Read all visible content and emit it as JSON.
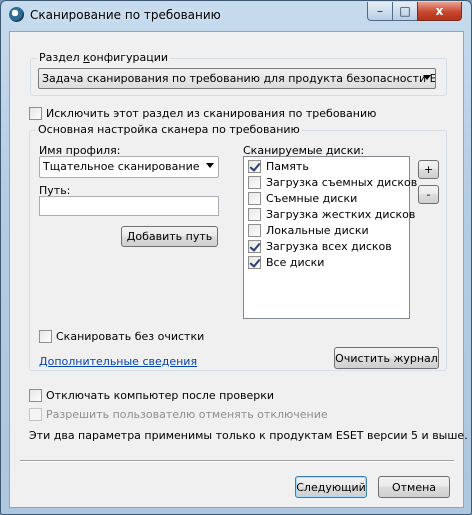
{
  "window": {
    "title": "Сканирование по требованию",
    "controls": {
      "minimize": "–",
      "maximize": "□",
      "close": "x"
    }
  },
  "config_section": {
    "label": "Раздел конфигурации",
    "label_underline_char": "к",
    "selected": "Задача сканирования по требованию для продукта безопасности ESET д"
  },
  "exclude_section": {
    "label": "Исключить этот раздел из сканирования по требованию",
    "checked": false
  },
  "scanner": {
    "group_title": "Основная настройка сканера по требованию",
    "profile_label": "Имя профиля:",
    "profile_value": "Тщательное сканирование",
    "path_label": "Путь:",
    "path_value": "",
    "add_path_button": "Добавить путь",
    "no_cleaning_label": "Сканировать без очистки",
    "no_cleaning_checked": false,
    "more_info_link": "Дополнительные сведения",
    "drives_label": "Сканируемые диски:",
    "drives": [
      {
        "label": "Память",
        "checked": true
      },
      {
        "label": "Загрузка съемных дисков",
        "checked": false
      },
      {
        "label": "Съемные диски",
        "checked": false
      },
      {
        "label": "Загрузка жестких дисков",
        "checked": false
      },
      {
        "label": "Локальные диски",
        "checked": false
      },
      {
        "label": "Загрузка всех дисков",
        "checked": true
      },
      {
        "label": "Все диски",
        "checked": true
      }
    ],
    "plus_button": "+",
    "minus_button": "-",
    "clear_log_button": "Очистить журнал"
  },
  "shutdown": {
    "label": "Отключать компьютер после проверки",
    "checked": false,
    "allow_cancel_label": "Разрешить пользователю отменять отключение",
    "allow_cancel_enabled": false,
    "note": "Эти два параметра применимы только к продуктам ESET версии 5 и выше."
  },
  "footer": {
    "next_button": "Следующий",
    "cancel_button": "Отмена"
  }
}
